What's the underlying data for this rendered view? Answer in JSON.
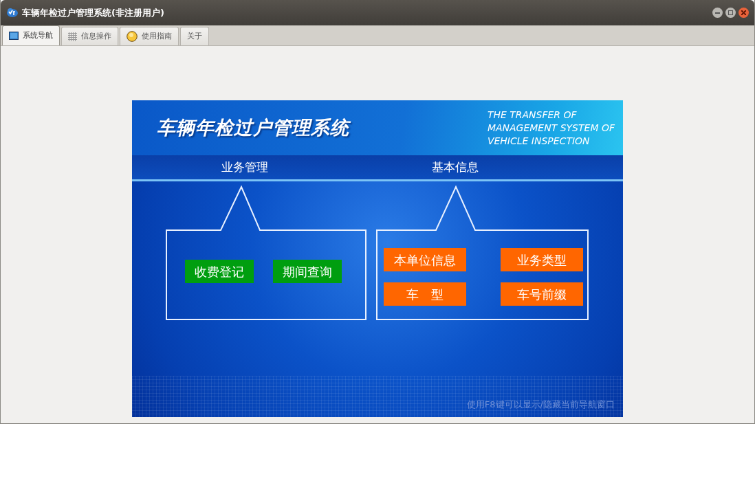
{
  "window": {
    "title": "车辆年检过户管理系统(非注册用户)"
  },
  "tabs": [
    {
      "label": "系统导航",
      "selected": true
    },
    {
      "label": "信息操作",
      "selected": false
    },
    {
      "label": "使用指南",
      "selected": false
    },
    {
      "label": "关于",
      "selected": false
    }
  ],
  "banner": {
    "title": "车辆年检过户管理系统",
    "subtitle_lines": [
      "THE TRANSFER OF",
      "MANAGEMENT SYSTEM OF",
      "VEHICLE INSPECTION"
    ],
    "sections": [
      {
        "heading": "业务管理",
        "buttons": [
          {
            "label": "收费登记",
            "color": "#009e0f"
          },
          {
            "label": "期间查询",
            "color": "#009e0f"
          }
        ]
      },
      {
        "heading": "基本信息",
        "buttons": [
          {
            "label": "本单位信息",
            "color": "#ff6600"
          },
          {
            "label": "业务类型",
            "color": "#ff6600"
          },
          {
            "label": "车　型",
            "color": "#ff6600"
          },
          {
            "label": "车号前缀",
            "color": "#ff6600"
          }
        ]
      }
    ],
    "hint": "使用F8键可以显示/隐藏当前导航窗口"
  }
}
